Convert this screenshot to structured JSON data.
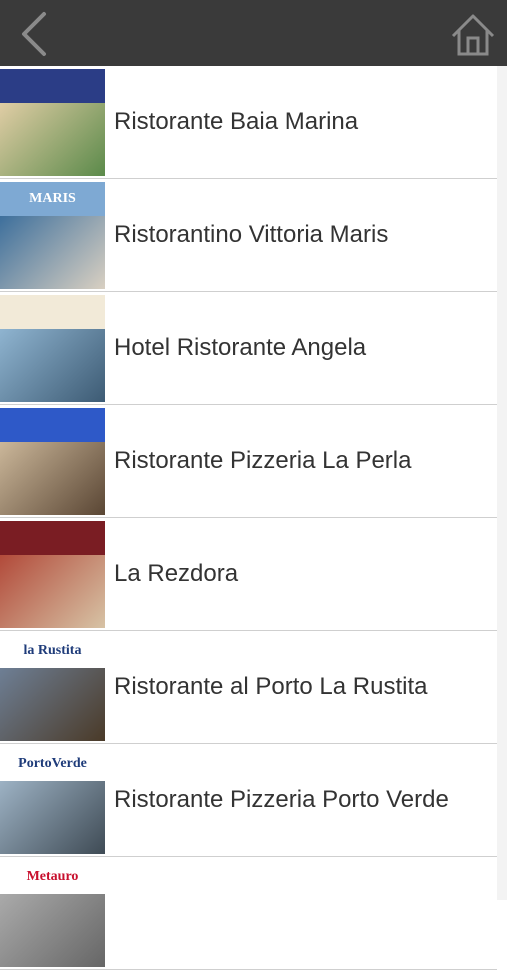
{
  "header": {
    "back_icon": "chevron-left-icon",
    "home_icon": "home-icon",
    "bg": "#3a3a3a"
  },
  "restaurants": [
    {
      "name": "Ristorante Baia Marina",
      "logo_text": "",
      "logo_bg": "#2b3d86",
      "photo_a": "#e0cda5",
      "photo_b": "#5b8a4a"
    },
    {
      "name": "Ristorantino Vittoria Maris",
      "logo_text": "MARIS",
      "logo_bg": "#7ea9d3",
      "photo_a": "#3d6f9c",
      "photo_b": "#d9d0c2"
    },
    {
      "name": "Hotel Ristorante Angela",
      "logo_text": "",
      "logo_bg": "#f2ead8",
      "photo_a": "#8fb4d0",
      "photo_b": "#3d5b74"
    },
    {
      "name": "Ristorante Pizzeria La Perla",
      "logo_text": "",
      "logo_bg": "#2e59c8",
      "photo_a": "#cbb79a",
      "photo_b": "#5a4634"
    },
    {
      "name": "La Rezdora",
      "logo_text": "",
      "logo_bg": "#7a1d23",
      "photo_a": "#b24a3a",
      "photo_b": "#d7c3a5"
    },
    {
      "name": "Ristorante al Porto La Rustita",
      "logo_text": "la Rustita",
      "logo_bg": "#ffffff",
      "photo_a": "#6e7f95",
      "photo_b": "#4a3a28"
    },
    {
      "name": "Ristorante Pizzeria Porto Verde",
      "logo_text": "PortoVerde",
      "logo_bg": "#ffffff",
      "photo_a": "#9db2c4",
      "photo_b": "#3f4b55"
    },
    {
      "name": "",
      "logo_text": "Metauro",
      "logo_bg": "#ffffff",
      "photo_a": "#aaaaaa",
      "photo_b": "#666666"
    }
  ]
}
